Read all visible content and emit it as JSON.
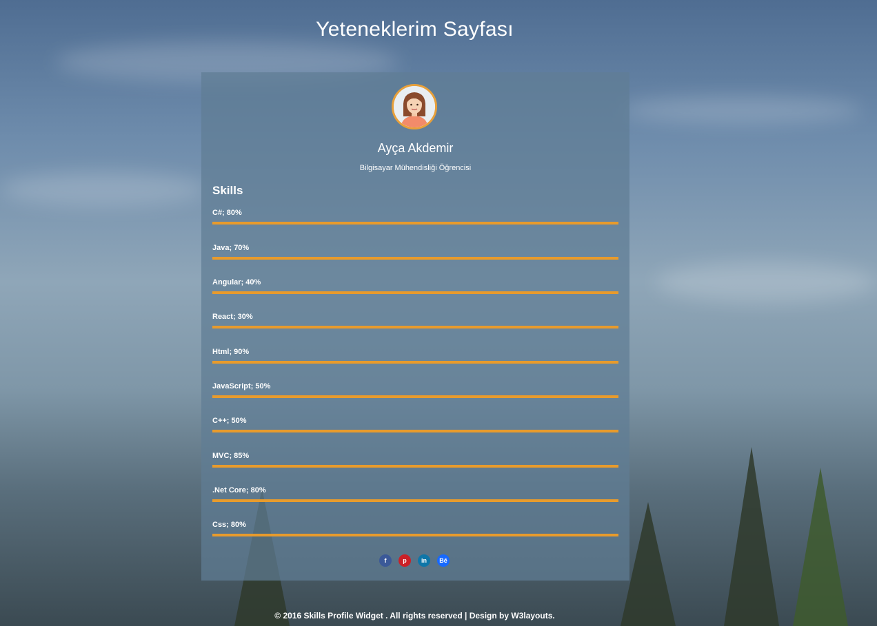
{
  "page": {
    "title": "Yeteneklerim Sayfası"
  },
  "profile": {
    "avatar_icon": "woman-avatar-icon",
    "name": "Ayça Akdemir",
    "role": "Bilgisayar Mühendisliği Öğrencisi"
  },
  "skills": {
    "heading": "Skills",
    "items": [
      {
        "label": "C#; 80%",
        "percent": 80
      },
      {
        "label": "Java; 70%",
        "percent": 70
      },
      {
        "label": "Angular; 40%",
        "percent": 40
      },
      {
        "label": "React; 30%",
        "percent": 30
      },
      {
        "label": "Html; 90%",
        "percent": 90
      },
      {
        "label": "JavaScript; 50%",
        "percent": 50
      },
      {
        "label": "C++; 50%",
        "percent": 50
      },
      {
        "label": "MVC; 85%",
        "percent": 85
      },
      {
        "label": ".Net Core; 80%",
        "percent": 80
      },
      {
        "label": "Css; 80%",
        "percent": 80
      }
    ],
    "bar_color": "#e89b2c"
  },
  "social": [
    {
      "icon": "facebook-icon",
      "glyph": "f",
      "color": "#3b5998"
    },
    {
      "icon": "pinterest-icon",
      "glyph": "p",
      "color": "#cb2027"
    },
    {
      "icon": "linkedin-icon",
      "glyph": "in",
      "color": "#0e76a8"
    },
    {
      "icon": "behance-icon",
      "glyph": "Bē",
      "color": "#1769ff"
    }
  ],
  "footer": {
    "text": "© 2016 Skills Profile Widget . All rights reserved | Design by W3layouts."
  }
}
